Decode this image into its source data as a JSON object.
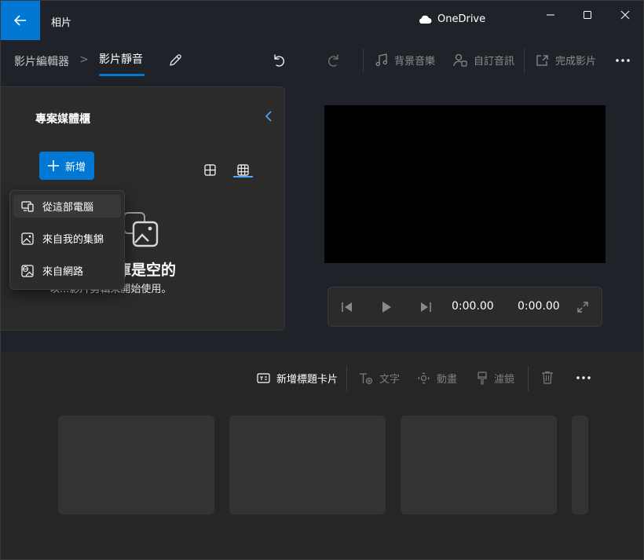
{
  "titlebar": {
    "app_title": "相片",
    "cloud_label": "OneDrive",
    "icons": {
      "back": "arrow-left-icon",
      "cloud": "cloud-icon",
      "minimize": "minimize-icon",
      "maximize": "maximize-icon",
      "close": "close-icon"
    },
    "accent": "#0078d4"
  },
  "commandbar": {
    "breadcrumb_parent": "影片編輯器",
    "breadcrumb_separator": ">",
    "breadcrumb_current": "影片靜音",
    "background_music": "背景音樂",
    "custom_audio": "自訂音訊",
    "finish_video": "完成影片"
  },
  "media_panel": {
    "title": "專案媒體櫃",
    "add_label": "新增",
    "empty_title": "案庫是空的",
    "empty_subtitle": "以...影片剪輯來開始使用。",
    "menu_items": [
      {
        "label": "從這部電腦",
        "icon": "computer-icon"
      },
      {
        "label": "來自我的集錦",
        "icon": "image-icon"
      },
      {
        "label": "來自網路",
        "icon": "web-image-icon"
      }
    ]
  },
  "player": {
    "current_time": "0:00.00",
    "total_time": "0:00.00"
  },
  "storyboard": {
    "add_title_card": "新增標題卡片",
    "text": "文字",
    "motion": "動畫",
    "filters": "濾鏡"
  }
}
